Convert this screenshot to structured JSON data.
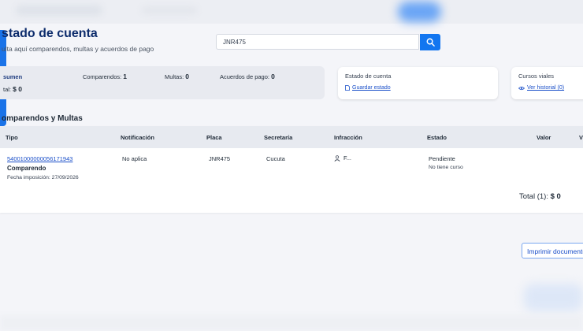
{
  "header": {
    "title": "stado de cuenta",
    "subtitle": "ulta aquí comparendos, multas y acuerdos de pago"
  },
  "search": {
    "value": "JNR475",
    "button_icon": "search-icon"
  },
  "resumen": {
    "label": "sumen",
    "comparendos_label": "Comparendos:",
    "comparendos_value": "1",
    "multas_label": "Multas:",
    "multas_value": "0",
    "acuerdos_label": "Acuerdos de pago:",
    "acuerdos_value": "0",
    "total_label": "tal:",
    "total_value": "$ 0"
  },
  "estado_card": {
    "title": "Estado de cuenta",
    "link": "Guardar estado",
    "icon": "document-icon"
  },
  "cursos_card": {
    "title": "Cursos viales",
    "link": "Ver historial (0)",
    "icon": "eye-icon"
  },
  "section": {
    "title": "omparendos y Multas"
  },
  "table": {
    "headers": [
      "Tipo",
      "Notificación",
      "Placa",
      "Secretaría",
      "Infracción",
      "Estado",
      "Valor",
      "V"
    ],
    "row": {
      "numero": "54001000000056171943",
      "tipo": "Comparendo",
      "fecha": "Fecha imposición: 27/09/2026",
      "notificacion": "No aplica",
      "placa": "JNR475",
      "secretaria": "Cucuta",
      "infraccion": "F...",
      "infraccion_icon": "person-icon",
      "estado": "Pendiente",
      "estado_detalle": "No tiene curso"
    },
    "total_label": "Total (1):",
    "total_value": "$ 0"
  },
  "actions": {
    "print_label": "Imprimir documento"
  },
  "colors": {
    "primary": "#1276f0",
    "title": "#0d2c6c",
    "link": "#1a4fc9"
  }
}
